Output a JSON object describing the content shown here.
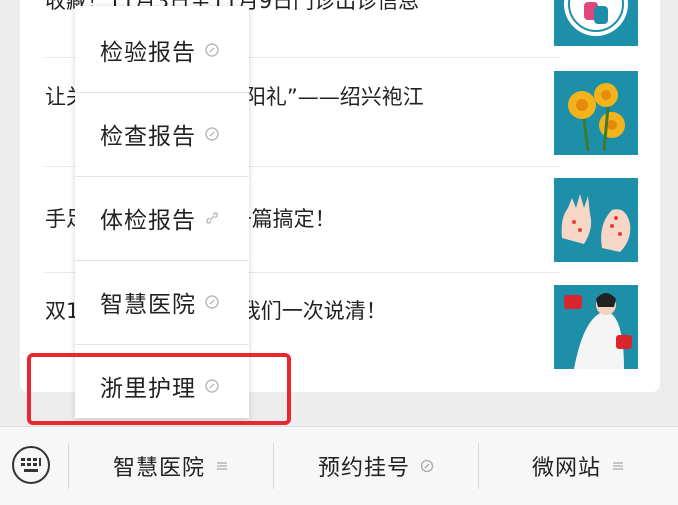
{
  "articles": [
    {
      "title": "收藏！11月3日至11月9日门诊出诊信息"
    },
    {
      "title": "让关爱老人最暖的“重阳礼”——绍兴袍江"
    },
    {
      "title": "手足口病预防+护理一篇搞定！"
    },
    {
      "title": "双11心的焕颜问题，我们一次说清！"
    }
  ],
  "menu": {
    "items": [
      {
        "label": "检验报告",
        "icon": "link-icon"
      },
      {
        "label": "检查报告",
        "icon": "link-icon"
      },
      {
        "label": "体检报告",
        "icon": "link-icon"
      },
      {
        "label": "智慧医院",
        "icon": "link-icon"
      },
      {
        "label": "浙里护理",
        "icon": "link-icon"
      }
    ]
  },
  "bottom_bar": {
    "keyboard_icon": "keyboard-icon",
    "tabs": [
      {
        "label": "智慧医院",
        "icon": "menu-icon"
      },
      {
        "label": "预约挂号",
        "icon": "link-icon"
      },
      {
        "label": "微网站",
        "icon": "menu-icon"
      }
    ]
  },
  "colors": {
    "highlight": "#e8282f",
    "thumb_teal": "#1e8fa8"
  }
}
